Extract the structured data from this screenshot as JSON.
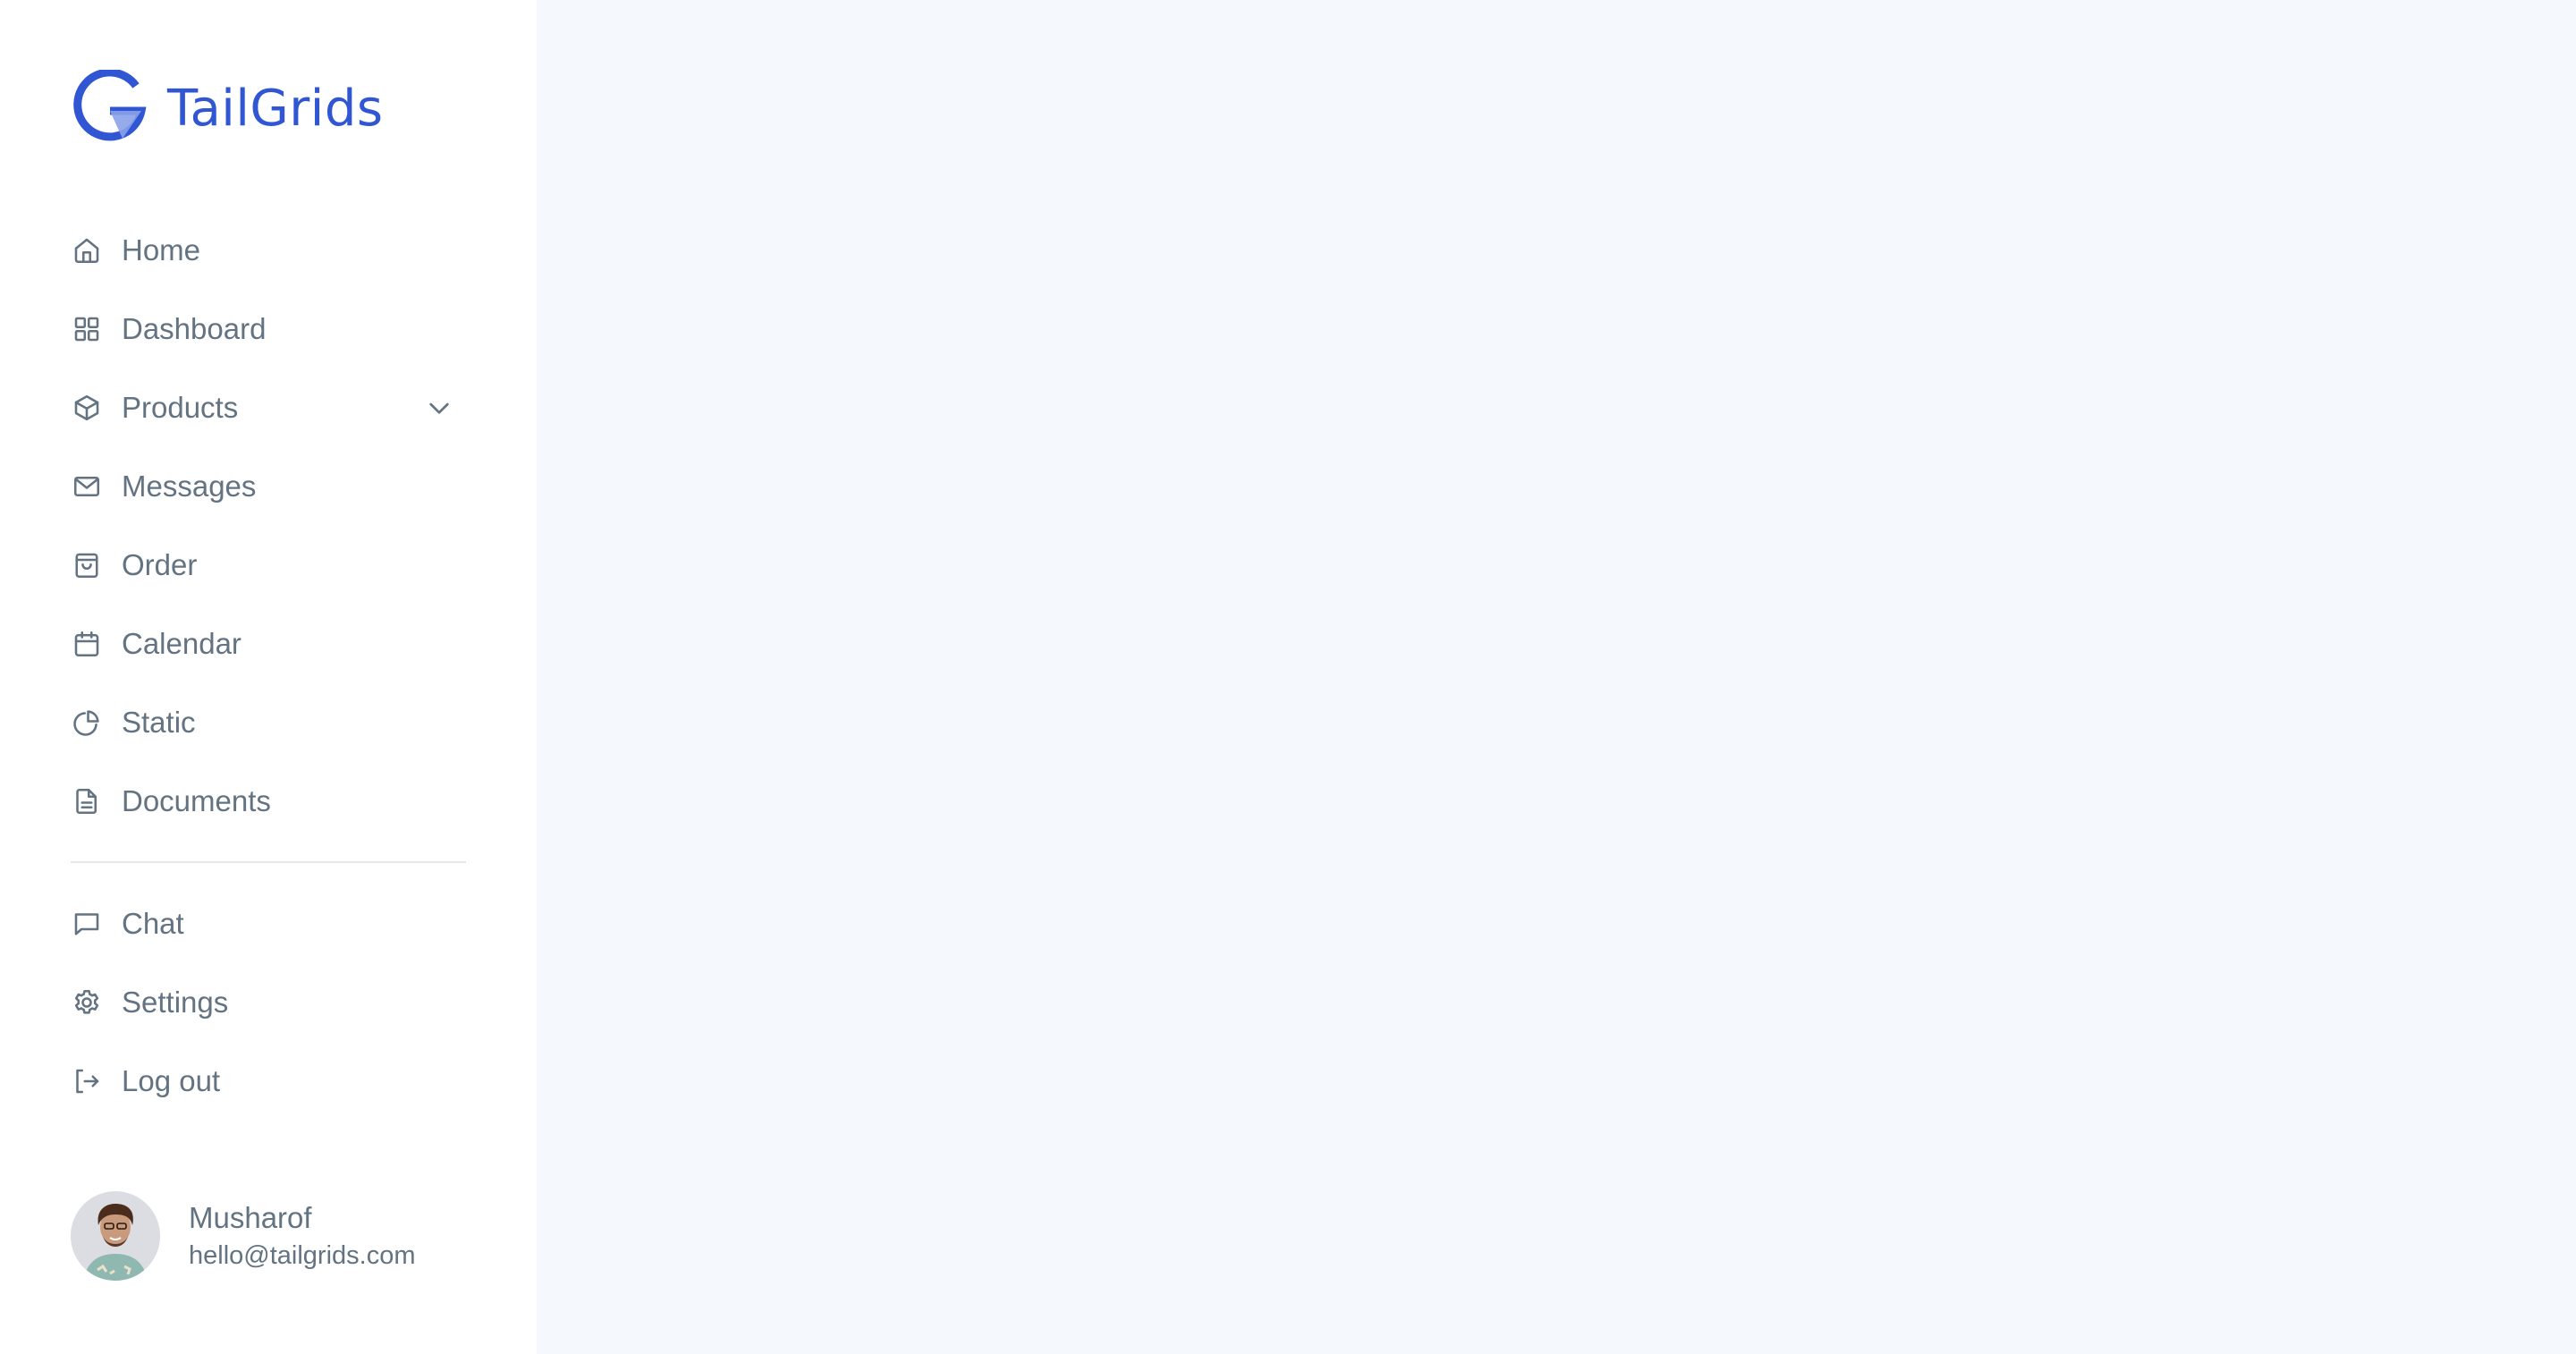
{
  "brand": {
    "name": "TailGrids",
    "color": "#3056d3",
    "logo_icon": "tailgrids-g-logo-icon"
  },
  "sidebar": {
    "primary_items": [
      {
        "label": "Home",
        "icon": "home-icon"
      },
      {
        "label": "Dashboard",
        "icon": "grid-icon"
      },
      {
        "label": "Products",
        "icon": "box-icon",
        "has_dropdown": true,
        "dropdown_icon": "chevron-down-icon"
      },
      {
        "label": "Messages",
        "icon": "mail-icon"
      },
      {
        "label": "Order",
        "icon": "shopping-bag-icon"
      },
      {
        "label": "Calendar",
        "icon": "calendar-icon"
      },
      {
        "label": "Static",
        "icon": "pie-chart-icon"
      },
      {
        "label": "Documents",
        "icon": "document-icon"
      }
    ],
    "secondary_items": [
      {
        "label": "Chat",
        "icon": "chat-icon"
      },
      {
        "label": "Settings",
        "icon": "gear-icon"
      },
      {
        "label": "Log out",
        "icon": "logout-icon"
      }
    ],
    "text_color": "#637381"
  },
  "user": {
    "name": "Musharof",
    "email": "hello@tailgrids.com"
  },
  "colors": {
    "sidebar_bg": "#ffffff",
    "main_bg": "#f5f8fc",
    "divider": "#e7e7e7"
  }
}
